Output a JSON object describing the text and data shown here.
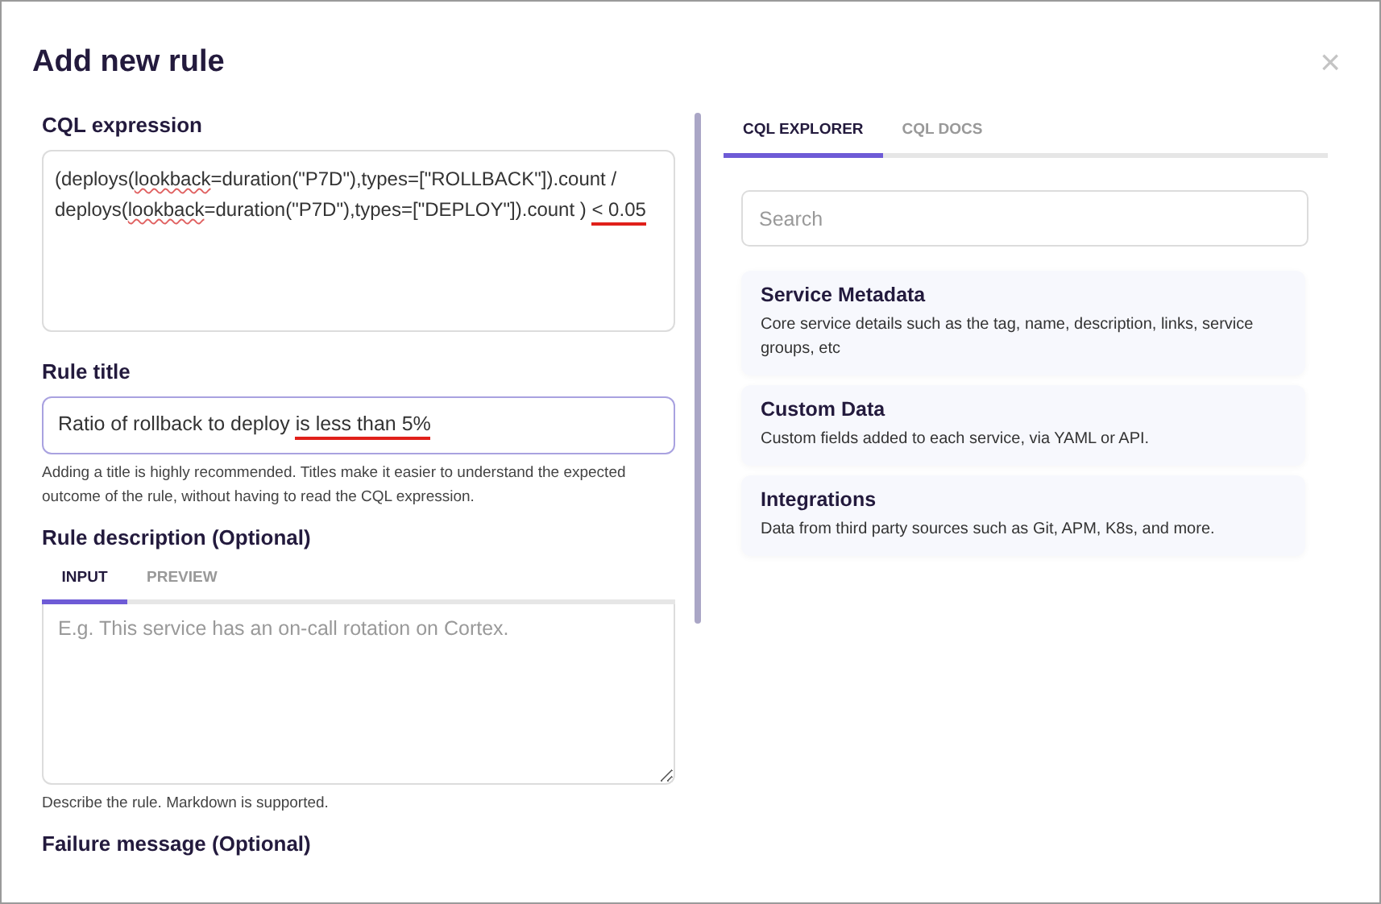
{
  "dialog": {
    "title": "Add new rule",
    "close": "×"
  },
  "cql": {
    "label": "CQL expression",
    "lines": [
      [
        {
          "text": "(deploys("
        },
        {
          "text": "lookback",
          "misspelled": true
        },
        {
          "text": "=duration(\"P7D\"),types=[\"ROLLBACK\"]).count /"
        }
      ],
      [
        {
          "text": "deploys("
        },
        {
          "text": "lookback",
          "misspelled": true
        },
        {
          "text": "=duration(\"P7D\"),types=[\"DEPLOY\"]).count ) "
        },
        {
          "text": "< 0.05",
          "annotated": true
        }
      ]
    ]
  },
  "rule_title": {
    "label": "Rule title",
    "value": [
      {
        "text": "Ratio of rollback to deploy "
      },
      {
        "text": "is less than 5%",
        "annotated": true
      }
    ],
    "help": "Adding a title is highly recommended. Titles make it easier to understand the expected outcome of the rule, without having to read the CQL expression."
  },
  "description": {
    "label": "Rule description (Optional)",
    "tabs": [
      {
        "label": "INPUT",
        "selected": true
      },
      {
        "label": "PREVIEW",
        "selected": false
      }
    ],
    "placeholder": "E.g. This service has an on-call rotation on Cortex.",
    "help": "Describe the rule. Markdown is supported."
  },
  "failure": {
    "label": "Failure message (Optional)"
  },
  "explorer": {
    "tabs": [
      {
        "label": "CQL EXPLORER",
        "selected": true
      },
      {
        "label": "CQL DOCS",
        "selected": false
      }
    ],
    "search": {
      "placeholder": "Search"
    },
    "items": [
      {
        "title": "Service Metadata",
        "description": "Core service details such as the tag, name, description, links, service groups, etc"
      },
      {
        "title": "Custom Data",
        "description": "Custom fields added to each service, via YAML or API."
      },
      {
        "title": "Integrations",
        "description": "Data from third party sources such as Git, APM, K8s, and more."
      }
    ]
  }
}
